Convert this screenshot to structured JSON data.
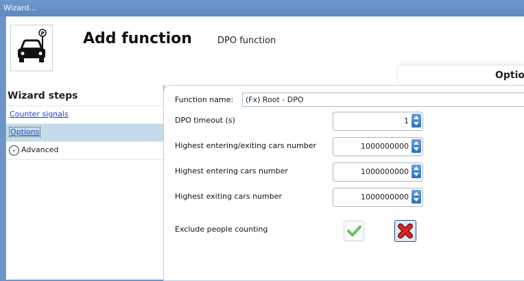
{
  "window": {
    "title": "Wizard..."
  },
  "header": {
    "title": "Add function",
    "subtitle": "DPO function",
    "tab_label": "Optio"
  },
  "sidebar": {
    "title": "Wizard steps",
    "items": [
      {
        "label": "Counter signals",
        "selected": false
      },
      {
        "label": "Options",
        "selected": true
      },
      {
        "label": "Advanced",
        "icon": "chevron-down-circle-icon"
      }
    ]
  },
  "form": {
    "function_name_label": "Function name:",
    "function_name_value": "(Fx) Root - DPO",
    "fields": [
      {
        "label": "DPO timeout (s)",
        "value": "1"
      },
      {
        "label": "Highest entering/exiting cars number",
        "value": "1000000000"
      },
      {
        "label": "Highest entering cars number",
        "value": "1000000000"
      },
      {
        "label": "Highest exiting cars number",
        "value": "1000000000"
      }
    ],
    "exclude_label": "Exclude people counting"
  },
  "colors": {
    "accent": "#2a6fc0",
    "titlebar": "#6d94c6",
    "selected_step": "#c4dcea",
    "check": "#6cbf57",
    "cross": "#d62828"
  }
}
